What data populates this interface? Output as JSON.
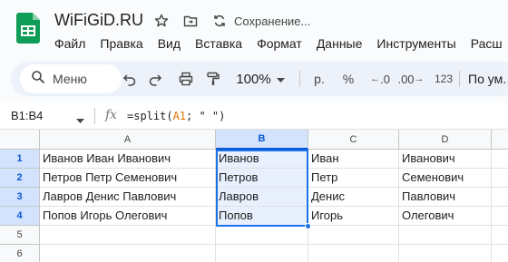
{
  "header": {
    "title": "WiFiGiD.RU",
    "status": "Сохранение..."
  },
  "menu": [
    "Файл",
    "Правка",
    "Вид",
    "Вставка",
    "Формат",
    "Данные",
    "Инструменты",
    "Расш"
  ],
  "toolbar": {
    "search_label": "Меню",
    "zoom": "100%",
    "currency": "р.",
    "percent": "%",
    "dec_decrease": ".0",
    "dec_increase": ".00",
    "number_format": "123",
    "font_label": "По ум."
  },
  "formula_bar": {
    "name_box": "B1:B4",
    "formula_prefix": "=split(",
    "formula_ref": "A1",
    "formula_suffix": "; \" \")"
  },
  "grid": {
    "columns": [
      "A",
      "B",
      "C",
      "D"
    ],
    "rows": [
      "1",
      "2",
      "3",
      "4",
      "5",
      "6"
    ],
    "cells": [
      [
        "Иванов Иван Иванович",
        "Иванов",
        "Иван",
        "Иванович"
      ],
      [
        "Петров Петр Семенович",
        "Петров",
        "Петр",
        "Семенович"
      ],
      [
        "Лавров Денис Павлович",
        "Лавров",
        "Денис",
        "Павлович"
      ],
      [
        "Попов Игорь Олегович",
        "Попов",
        "Игорь",
        "Олегович"
      ],
      [
        "",
        "",
        "",
        ""
      ],
      [
        "",
        "",
        "",
        ""
      ]
    ]
  },
  "colors": {
    "accent": "#1a73e8",
    "selection_fill": "#e8f0fe",
    "header_selected": "#d3e3fd",
    "logo": "#0f9d58"
  }
}
